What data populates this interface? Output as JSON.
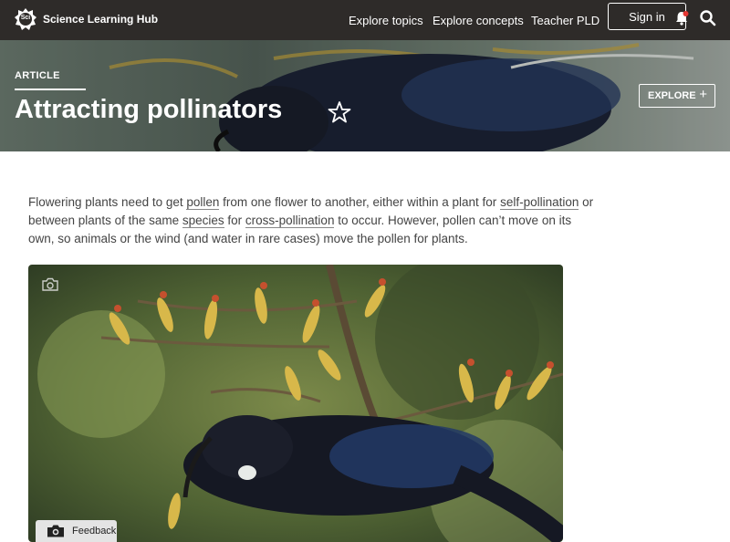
{
  "header": {
    "brand": "Science Learning Hub",
    "logo_text": "Sci",
    "nav": [
      "Explore topics",
      "Explore concepts",
      "Teacher PLD"
    ],
    "signin_label": "Sign in"
  },
  "hero": {
    "label": "ARTICLE",
    "title": "Attracting pollinators",
    "explore_label": "EXPLORE"
  },
  "intro": {
    "t1": "Flowering plants need to get ",
    "term1": "pollen",
    "t2": " from one flower to another, either within a plant for ",
    "term2": "self-pollination",
    "t3": " or between plants of the same ",
    "term3": "species",
    "t4": " for ",
    "term4": "cross-pollination",
    "t5": " to occur. However, pollen can’t move on its own, so animals or the wind (and water in rare cases) move the pollen for plants."
  },
  "feedback_label": "Feedback",
  "colors": {
    "topbar": "#2e2b29",
    "notification_dot": "#e53935"
  }
}
